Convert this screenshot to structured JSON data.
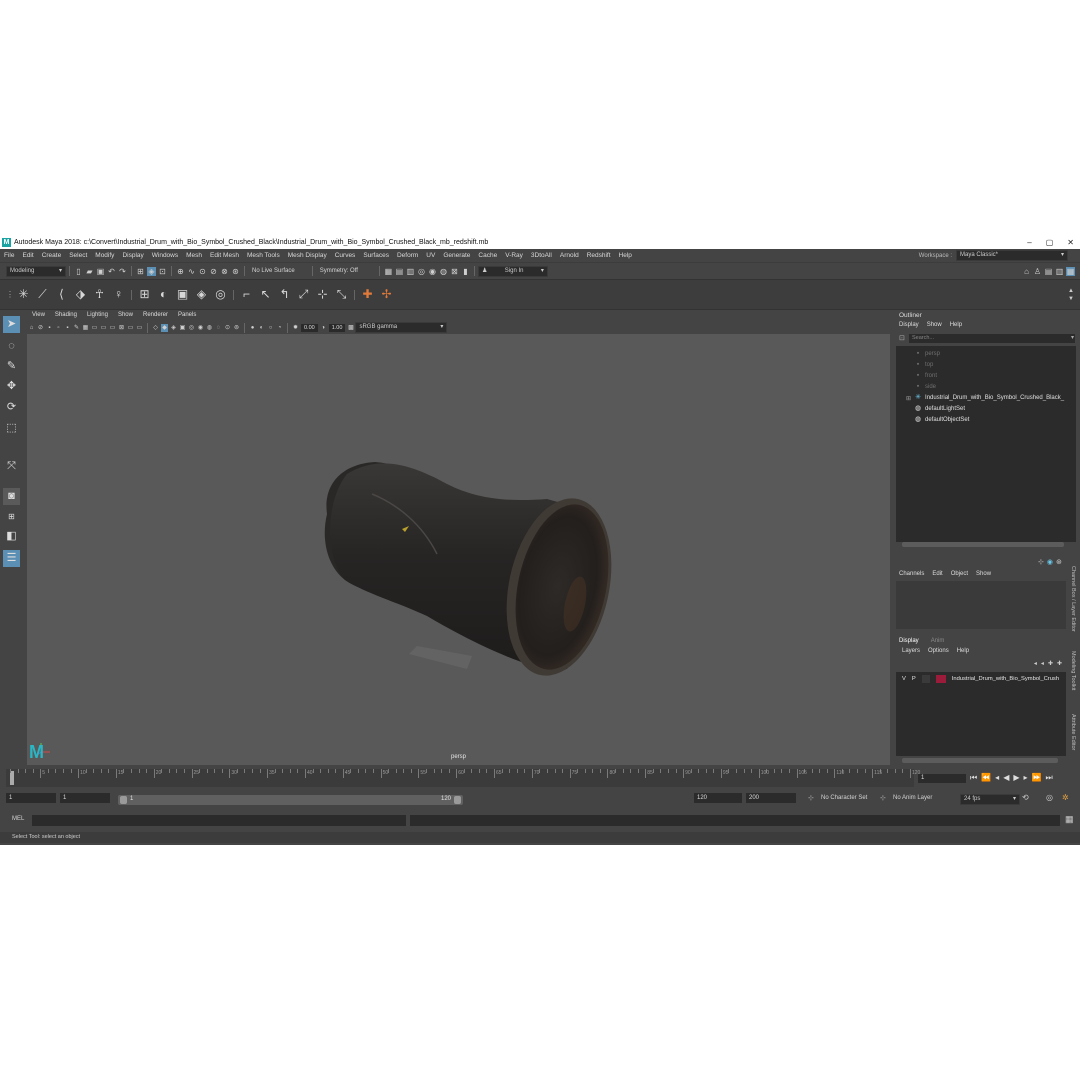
{
  "title": "Autodesk Maya 2018: c:\\Convert\\Industrial_Drum_with_Bio_Symbol_Crushed_Black\\Industrial_Drum_with_Bio_Symbol_Crushed_Black_mb_redshift.mb",
  "menu": [
    "File",
    "Edit",
    "Create",
    "Select",
    "Modify",
    "Display",
    "Windows",
    "Mesh",
    "Edit Mesh",
    "Mesh Tools",
    "Mesh Display",
    "Curves",
    "Surfaces",
    "Deform",
    "UV",
    "Generate",
    "Cache",
    "V-Ray",
    "3DtoAll",
    "Arnold",
    "Redshift",
    "Help"
  ],
  "workspace": {
    "label": "Workspace :",
    "value": "Maya Classic*"
  },
  "status": {
    "mode": "Modeling",
    "live_surface": "No Live Surface",
    "symmetry": "Symmetry: Off",
    "sign_in": "Sign In"
  },
  "viewport": {
    "menu": [
      "View",
      "Shading",
      "Lighting",
      "Show",
      "Renderer",
      "Panels"
    ],
    "exposure": "0.00",
    "gamma": "1.00",
    "color_space": "sRGB gamma",
    "camera": "persp"
  },
  "outliner": {
    "title": "Outliner",
    "menu": [
      "Display",
      "Show",
      "Help"
    ],
    "search_placeholder": "Search...",
    "items": [
      {
        "label": "persp",
        "dim": true
      },
      {
        "label": "top",
        "dim": true
      },
      {
        "label": "front",
        "dim": true
      },
      {
        "label": "side",
        "dim": true
      },
      {
        "label": "Industrial_Drum_with_Bio_Symbol_Crushed_Black_",
        "dim": false
      },
      {
        "label": "defaultLightSet",
        "dim": false
      },
      {
        "label": "defaultObjectSet",
        "dim": false
      }
    ]
  },
  "channel_box": {
    "menu": [
      "Channels",
      "Edit",
      "Object",
      "Show"
    ]
  },
  "layer_editor": {
    "tabs": [
      "Display",
      "Anim"
    ],
    "menu": [
      "Layers",
      "Options",
      "Help"
    ],
    "layer": {
      "v": "V",
      "p": "P",
      "name": "Industrial_Drum_with_Bio_Symbol_Crush",
      "color": "#9a1b3a"
    }
  },
  "side_tabs": [
    "Channel Box / Layer Editor",
    "Modeling Toolkit",
    "Attribute Editor"
  ],
  "timeline": {
    "ticks": [
      "5",
      "10",
      "15",
      "20",
      "25",
      "30",
      "35",
      "40",
      "45",
      "50",
      "55",
      "60",
      "65",
      "70",
      "75",
      "80",
      "85",
      "90",
      "95",
      "100",
      "105",
      "110",
      "115",
      "120"
    ],
    "current_frame": "1"
  },
  "range": {
    "start": "1",
    "playback_start": "1",
    "slider_start": "1",
    "slider_end": "120",
    "playback_end": "120",
    "end": "200",
    "character_set": "No Character Set",
    "anim_layer": "No Anim Layer",
    "fps": "24 fps"
  },
  "command_line": {
    "label": "MEL"
  },
  "help_line": "Select Tool: select an object",
  "colors": {
    "accent": "#5b8fb4",
    "logo": "#2ab6c4",
    "layer": "#9a1b3a"
  }
}
